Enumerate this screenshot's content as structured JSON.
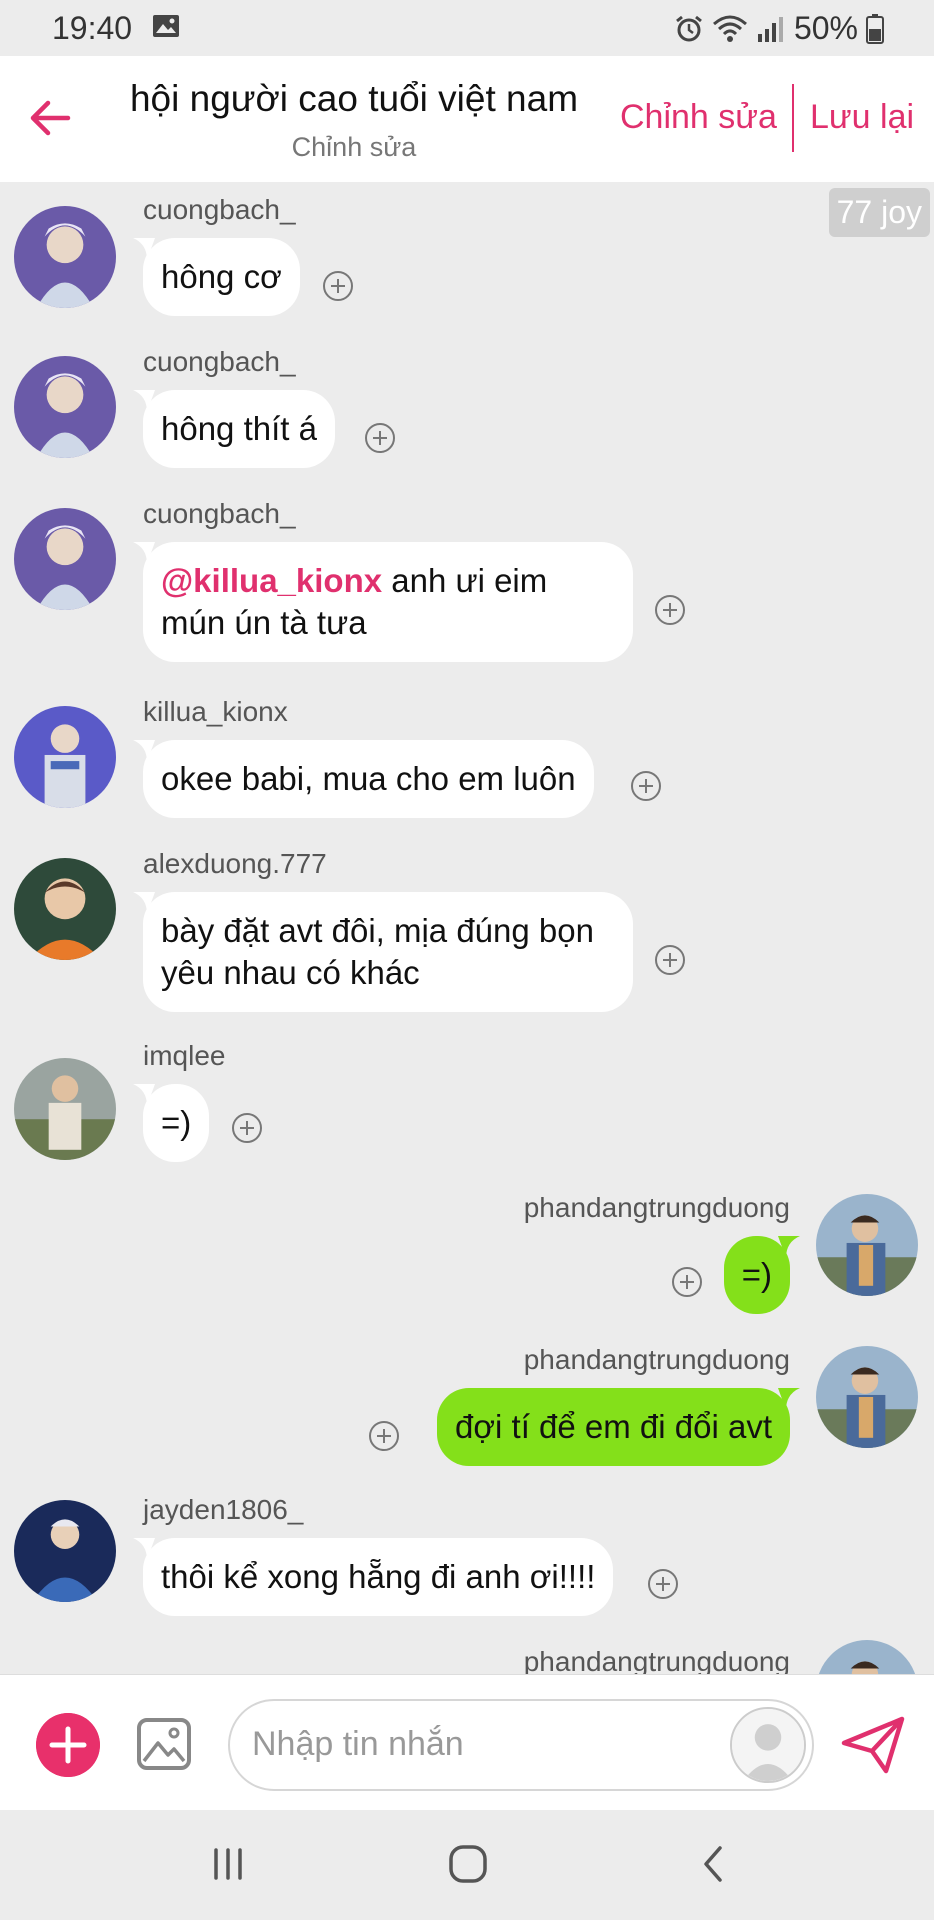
{
  "status_bar": {
    "time": "19:40",
    "battery": "50%",
    "icons": [
      "gallery-icon",
      "alarm-icon",
      "wifi-icon",
      "signal-icon",
      "battery-icon"
    ]
  },
  "header": {
    "title": "hội người cao tuổi việt nam",
    "subtitle": "Chỉnh sửa",
    "edit_label": "Chỉnh sửa",
    "save_label": "Lưu lại",
    "accent_color": "#e0306e"
  },
  "badge": {
    "joy": "77 joy"
  },
  "messages": [
    {
      "user": "cuongbach_",
      "side": "in",
      "text": "hông cơ",
      "avatar_color": "#8a78b8"
    },
    {
      "user": "cuongbach_",
      "side": "in",
      "text": "hông thít á",
      "avatar_color": "#8a78b8"
    },
    {
      "user": "cuongbach_",
      "side": "in",
      "mention": "@killua_kionx",
      "text": " anh ưi eim",
      "text2": "mún ún tà tưa",
      "avatar_color": "#8a78b8"
    },
    {
      "user": "killua_kionx",
      "side": "in",
      "text": "okee babi, mua cho em luôn",
      "avatar_color": "#6f6fd6"
    },
    {
      "user": "alexduong.777",
      "side": "in",
      "text": "bày đặt avt đôi, mịa đúng bọn",
      "text2": "yêu nhau có khác",
      "avatar_color": "#c77a3a"
    },
    {
      "user": "imqlee",
      "side": "in",
      "text": "=)",
      "avatar_color": "#7d8a6a"
    },
    {
      "user": "phandangtrungduong",
      "side": "out",
      "text": "=)",
      "avatar_color": "#7a8fa8"
    },
    {
      "user": "phandangtrungduong",
      "side": "out",
      "text": "đợi tí để em đi đổi avt",
      "avatar_color": "#7a8fa8"
    },
    {
      "user": "jayden1806_",
      "side": "in",
      "text": "thôi kể xong hẵng đi anh ơi!!!!",
      "avatar_color": "#2a3e7a"
    },
    {
      "user": "phandangtrungduong",
      "side": "out",
      "text": "",
      "avatar_color": "#7a8fa8"
    }
  ],
  "input": {
    "placeholder": "Nhập tin nhắn"
  },
  "colors": {
    "outgoing_bubble": "#84e01a",
    "incoming_bubble": "#ffffff",
    "background": "#ececec"
  }
}
